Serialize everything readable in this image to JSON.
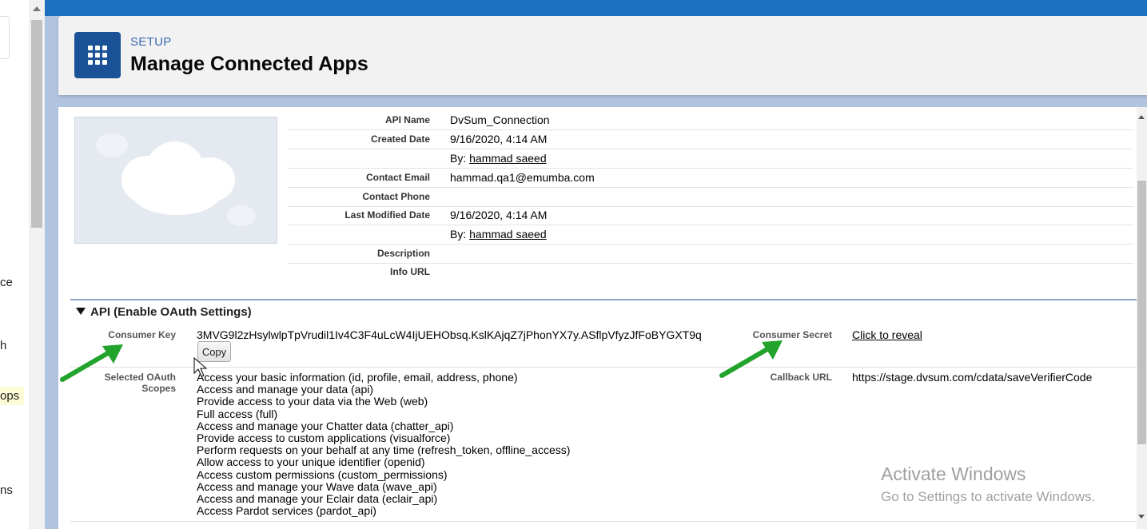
{
  "left_nav": {
    "fragments": [
      "ce",
      "h",
      "ops",
      "ns"
    ]
  },
  "header": {
    "eyebrow": "SETUP",
    "title": "Manage Connected Apps"
  },
  "details": [
    {
      "label": "API Name",
      "value": "DvSum_Connection"
    },
    {
      "label": "Created Date",
      "value": "9/16/2020, 4:14 AM"
    },
    {
      "label": "",
      "value_prefix": "By:",
      "link": "hammad saeed"
    },
    {
      "label": "Contact Email",
      "value": "hammad.qa1@emumba.com"
    },
    {
      "label": "Contact Phone",
      "value": ""
    },
    {
      "label": "Last Modified Date",
      "value": "9/16/2020, 4:14 AM"
    },
    {
      "label": "",
      "value_prefix": "By:",
      "link": "hammad saeed"
    },
    {
      "label": "Description",
      "value": ""
    },
    {
      "label": "Info URL",
      "value": ""
    }
  ],
  "api_section": {
    "title": "API (Enable OAuth Settings)",
    "consumer_key_label": "Consumer Key",
    "consumer_key": "3MVG9l2zHsylwlpTpVrudil1Iv4C3F4uLcW4IjUEHObsq.KslKAjqZ7jPhonYX7y.ASflpVfyzJfFoBYGXT9q",
    "copy_label": "Copy",
    "consumer_secret_label": "Consumer Secret",
    "consumer_secret_link": "Click to reveal",
    "scopes_label_line1": "Selected OAuth",
    "scopes_label_line2": "Scopes",
    "scopes": [
      "Access your basic information (id, profile, email, address, phone)",
      "Access and manage your data (api)",
      "Provide access to your data via the Web (web)",
      "Full access (full)",
      "Access and manage your Chatter data (chatter_api)",
      "Provide access to custom applications (visualforce)",
      "Perform requests on your behalf at any time (refresh_token, offline_access)",
      "Allow access to your unique identifier (openid)",
      "Access custom permissions (custom_permissions)",
      "Access and manage your Wave data (wave_api)",
      "Access and manage your Eclair data (eclair_api)",
      "Access Pardot services (pardot_api)"
    ],
    "callback_label": "Callback URL",
    "callback_url": "https://stage.dvsum.com/cdata/saveVerifierCode"
  },
  "watermark": {
    "line1": "Activate Windows",
    "line2": "Go to Settings to activate Windows."
  },
  "colors": {
    "brand_blue": "#1b5297",
    "arrow_green": "#22a32b"
  }
}
